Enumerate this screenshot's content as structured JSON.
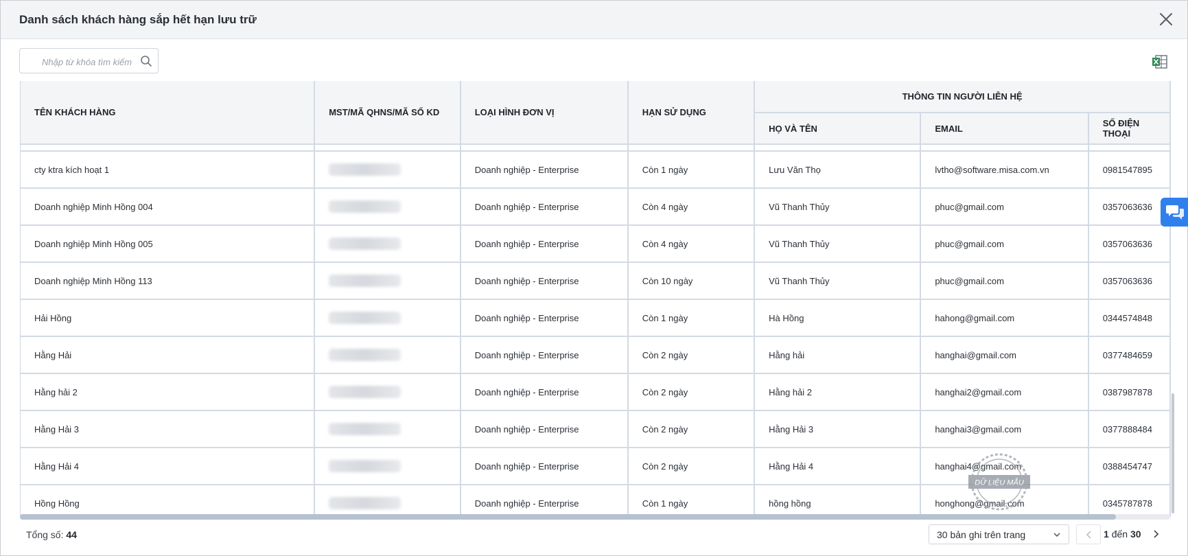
{
  "dialog": {
    "title": "Danh sách khách hàng sắp hết hạn lưu trữ",
    "close_icon": "close-icon"
  },
  "search": {
    "placeholder": "Nhập từ khóa tìm kiếm",
    "value": ""
  },
  "toolbar": {
    "export_icon": "excel-export-icon"
  },
  "table": {
    "headers": {
      "customer_name": "TÊN KHÁCH HÀNG",
      "tax_code": "MST/MÃ QHNS/MÃ SỐ KD",
      "unit_type": "LOẠI HÌNH ĐƠN VỊ",
      "expiry": "HẠN SỬ DỤNG",
      "contact_group": "THÔNG TIN NGƯỜI LIÊN HỆ",
      "contact_name": "HỌ VÀ TÊN",
      "email": "EMAIL",
      "phone": "SỐ ĐIỆN THOẠI"
    },
    "rows": [
      {
        "name": "cty ktra kích hoạt 1",
        "type": "Doanh nghiệp - Enterprise",
        "expiry": "Còn 1 ngày",
        "contact": "Lưu Văn Thọ",
        "email": "lvtho@software.misa.com.vn",
        "phone": "0981547895"
      },
      {
        "name": "Doanh nghiệp Minh Hồng 004",
        "type": "Doanh nghiệp - Enterprise",
        "expiry": "Còn 4 ngày",
        "contact": "Vũ Thanh Thủy",
        "email": "phuc@gmail.com",
        "phone": "0357063636"
      },
      {
        "name": "Doanh nghiệp Minh Hồng 005",
        "type": "Doanh nghiệp - Enterprise",
        "expiry": "Còn 4 ngày",
        "contact": "Vũ Thanh Thủy",
        "email": "phuc@gmail.com",
        "phone": "0357063636"
      },
      {
        "name": "Doanh nghiệp Minh Hồng 113",
        "type": "Doanh nghiệp - Enterprise",
        "expiry": "Còn 10 ngày",
        "contact": "Vũ Thanh Thủy",
        "email": "phuc@gmail.com",
        "phone": "0357063636"
      },
      {
        "name": "Hải Hồng",
        "type": "Doanh nghiệp - Enterprise",
        "expiry": "Còn 1 ngày",
        "contact": "Hà Hồng",
        "email": "hahong@gmail.com",
        "phone": "0344574848"
      },
      {
        "name": "Hằng Hải",
        "type": "Doanh nghiệp - Enterprise",
        "expiry": "Còn 2 ngày",
        "contact": "Hằng hải",
        "email": "hanghai@gmail.com",
        "phone": "0377484659"
      },
      {
        "name": "Hằng hải 2",
        "type": "Doanh nghiệp - Enterprise",
        "expiry": "Còn 2 ngày",
        "contact": "Hằng hải 2",
        "email": "hanghai2@gmail.com",
        "phone": "0387987878"
      },
      {
        "name": "Hằng Hải 3",
        "type": "Doanh nghiệp - Enterprise",
        "expiry": "Còn 2 ngày",
        "contact": "Hằng Hải 3",
        "email": "hanghai3@gmail.com",
        "phone": "0377888484"
      },
      {
        "name": "Hằng Hải 4",
        "type": "Doanh nghiệp - Enterprise",
        "expiry": "Còn 2 ngày",
        "contact": "Hằng Hải 4",
        "email": "hanghai4@gmail.com",
        "phone": "0388454747"
      },
      {
        "name": "Hồng Hồng",
        "type": "Doanh nghiệp - Enterprise",
        "expiry": "Còn 1 ngày",
        "contact": "hồng hồng",
        "email": "honghong@gmail.com",
        "phone": "0345787878"
      }
    ]
  },
  "footer": {
    "total_label": "Tổng số:",
    "total_value": "44",
    "page_size": "30 bản ghi trên trang",
    "range_from": "1",
    "range_sep": "đến",
    "range_to": "30"
  },
  "watermark": {
    "text": "DỮ LIỆU MẪU"
  },
  "chat": {
    "icon": "chat-bubble-icon"
  },
  "colors": {
    "accent": "#2f80ed",
    "header_bg": "#f4f5f7",
    "grid_line": "#d3dae4"
  }
}
